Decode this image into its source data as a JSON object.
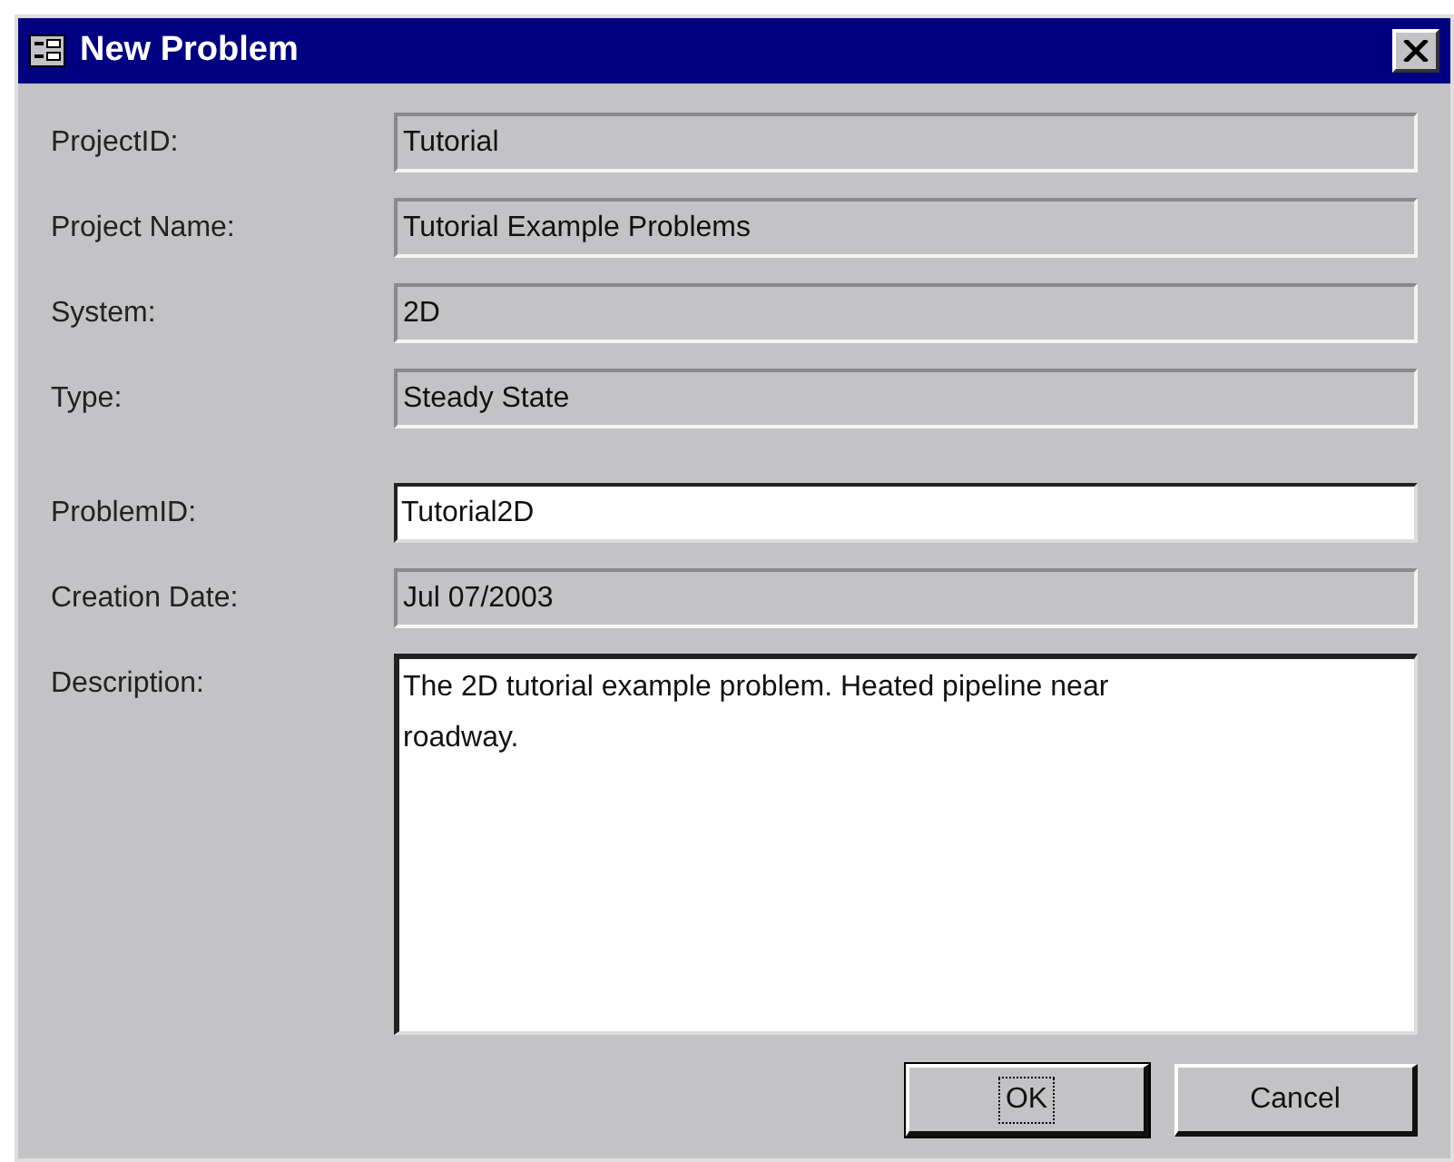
{
  "window": {
    "title": "New Problem"
  },
  "fields": [
    {
      "label": "ProjectID:",
      "value": "Tutorial",
      "kind": "readonly"
    },
    {
      "label": "Project Name:",
      "value": "Tutorial Example Problems",
      "kind": "readonly"
    },
    {
      "label": "System:",
      "value": "2D",
      "kind": "readonly"
    },
    {
      "label": "Type:",
      "value": "Steady State",
      "kind": "readonly"
    },
    {
      "label": "ProblemID:",
      "value": "Tutorial2D",
      "kind": "editable",
      "gap_before": true
    },
    {
      "label": "Creation Date:",
      "value": "Jul 07/2003",
      "kind": "readonly"
    },
    {
      "label": "Description:",
      "value": "The 2D tutorial example problem. Heated pipeline near roadway.",
      "kind": "multiline"
    }
  ],
  "buttons": [
    {
      "label": "OK",
      "default": true
    },
    {
      "label": "Cancel",
      "default": false
    }
  ]
}
